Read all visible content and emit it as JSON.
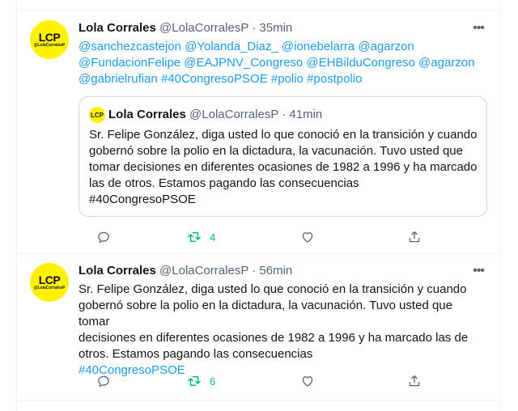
{
  "colors": {
    "link": "#1d9bf0",
    "retweet_active": "#00ba7c",
    "secondary": "#536471",
    "avatar_bg": "#fff200"
  },
  "tweets": [
    {
      "author": {
        "name": "Lola Corrales",
        "handle": "@LolaCorralesP",
        "separator": "·",
        "time": "35min",
        "avatar_text": "LCP",
        "avatar_subtext": "@LolaCorralesP"
      },
      "more_icon": "more-dots-icon",
      "text_lines": [
        "@sanchezcastejon @Yolanda_Diaz_  @ionebelarra @agarzon",
        "@FundacionFelipe @EAJPNV_Congreso @EHBilduCongreso @agarzon",
        "@gabrielrufian #40CongresoPSOE #polio #postpolio"
      ],
      "quote": {
        "author": {
          "name": "Lola Corrales",
          "handle": "@LolaCorralesP",
          "separator": "·",
          "time": "41min",
          "avatar_text": "LCP"
        },
        "text_lines": [
          "Sr. Felipe González, diga usted lo que conoció en la transición y cuando",
          "gobernó sobre la polio en la dictadura, la vacunación. Tuvo usted que",
          "tomar decisiones en diferentes ocasiones de 1982 a 1996 y ha marcado",
          "las de otros. Estamos pagando las consecuencias",
          "#40CongresoPSOE"
        ]
      },
      "actions": {
        "reply_icon": "reply-icon",
        "retweet_icon": "retweet-icon",
        "retweet_count": "4",
        "like_icon": "heart-icon",
        "share_icon": "share-icon"
      }
    },
    {
      "author": {
        "name": "Lola Corrales",
        "handle": "@LolaCorralesP",
        "separator": "·",
        "time": "56min",
        "avatar_text": "LCP",
        "avatar_subtext": "@LolaCorralesP"
      },
      "more_icon": "more-dots-icon",
      "text_lines": [
        "Sr. Felipe González, diga usted lo que conoció en la transición y cuando",
        "gobernó sobre la polio en la dictadura, la vacunación. Tuvo usted que tomar",
        "decisiones en diferentes ocasiones de 1982 a 1996 y ha marcado las de",
        "otros. Estamos pagando las consecuencias",
        "#40CongresoPSOE"
      ],
      "actions": {
        "reply_icon": "reply-icon",
        "retweet_icon": "retweet-icon",
        "retweet_count": "6",
        "like_icon": "heart-icon",
        "share_icon": "share-icon"
      }
    }
  ]
}
